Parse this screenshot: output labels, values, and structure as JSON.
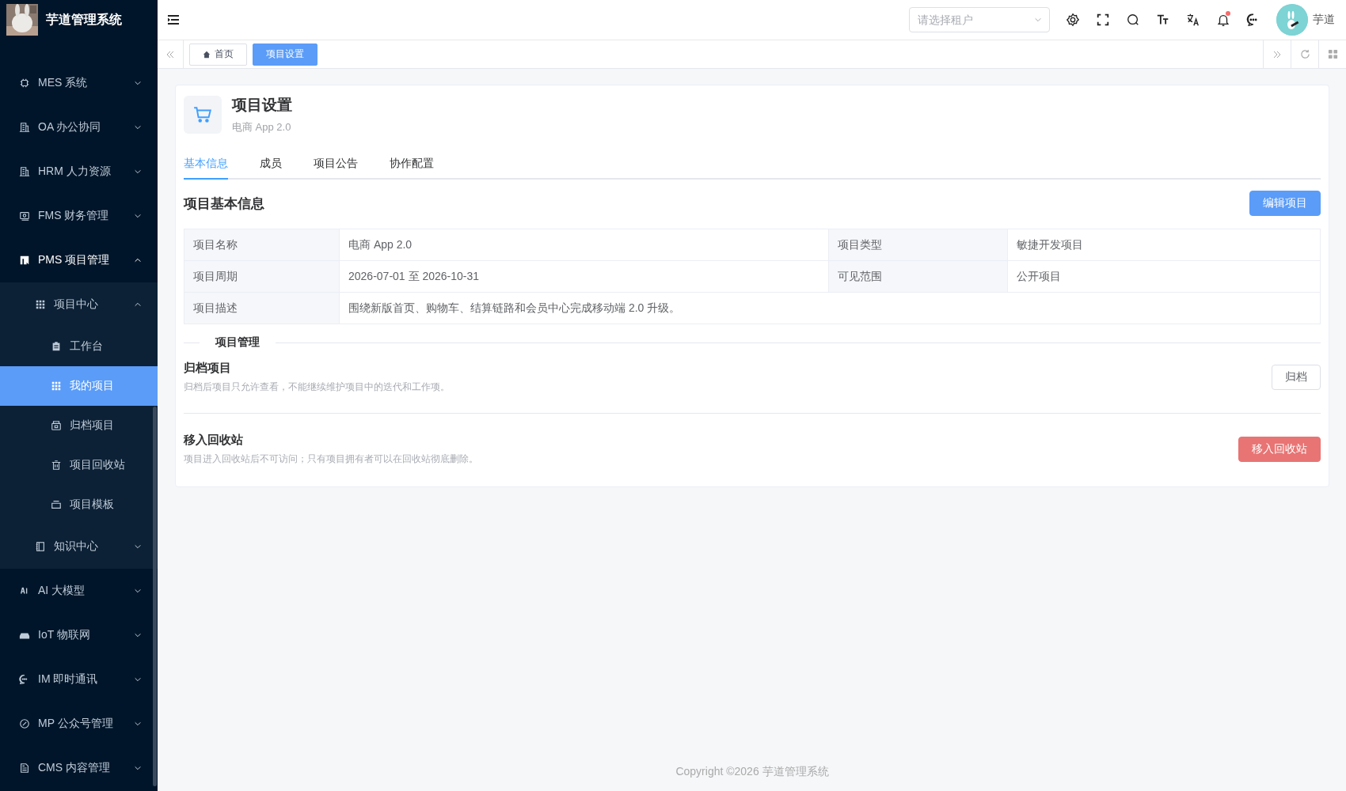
{
  "sidebar": {
    "logo_title": "芋道管理系统",
    "menu": [
      {
        "label": "MES 系统",
        "expanded": false
      },
      {
        "label": "OA 办公协同",
        "expanded": false
      },
      {
        "label": "HRM 人力资源",
        "expanded": false
      },
      {
        "label": "FMS 财务管理",
        "expanded": false
      },
      {
        "label": "PMS 项目管理",
        "expanded": true,
        "children": [
          {
            "label": "项目中心",
            "expanded": true,
            "children": [
              {
                "label": "工作台",
                "selected": false
              },
              {
                "label": "我的项目",
                "selected": true
              },
              {
                "label": "归档项目",
                "selected": false
              },
              {
                "label": "项目回收站",
                "selected": false
              },
              {
                "label": "项目模板",
                "selected": false
              }
            ]
          },
          {
            "label": "知识中心",
            "expanded": false
          }
        ]
      },
      {
        "label": "AI 大模型",
        "expanded": false
      },
      {
        "label": "IoT 物联网",
        "expanded": false
      },
      {
        "label": "IM 即时通讯",
        "expanded": false
      },
      {
        "label": "MP 公众号管理",
        "expanded": false
      },
      {
        "label": "CMS 内容管理",
        "expanded": false
      }
    ]
  },
  "header": {
    "tenant_select": {
      "placeholder": "请选择租户"
    },
    "notification_dot": true,
    "user_name": "芋道"
  },
  "tags": [
    {
      "label": "首页",
      "selected": false
    },
    {
      "label": "项目设置",
      "selected": true
    }
  ],
  "page": {
    "title": "项目设置",
    "subtitle": "电商 App 2.0",
    "tabs": [
      {
        "label": "基本信息",
        "selected": true
      },
      {
        "label": "成员",
        "selected": false
      },
      {
        "label": "项目公告",
        "selected": false
      },
      {
        "label": "协作配置",
        "selected": false
      }
    ],
    "section_title": "项目基本信息",
    "edit_button": "编辑项目",
    "info_rows": [
      {
        "label": "项目名称",
        "value": "电商 App 2.0",
        "label_2": "项目类型",
        "value_2": "敏捷开发项目"
      },
      {
        "label": "项目周期",
        "value": "2026-07-01 至 2026-10-31",
        "label_2": "可见范围",
        "value_2": "公开项目"
      },
      {
        "label": "项目描述",
        "value": "围绕新版首页、购物车、结算链路和会员中心完成移动端 2.0 升级。"
      }
    ],
    "management_divider": "项目管理",
    "actions": [
      {
        "kind": "normal",
        "title": "归档项目",
        "description": "归档后项目只允许查看，不能继续维护项目中的迭代和工作项。",
        "button": "归档"
      },
      {
        "kind": "danger",
        "title": "移入回收站",
        "description": "项目进入回收站后不可访问；只有项目拥有者可以在回收站彻底删除。",
        "button": "移入回收站"
      }
    ]
  },
  "footer": "Copyright ©2026 芋道管理系统"
}
